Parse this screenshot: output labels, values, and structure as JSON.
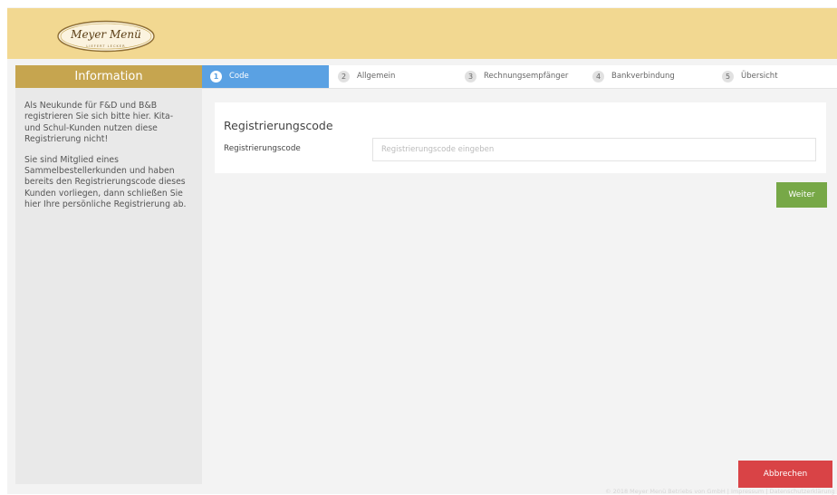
{
  "brand": {
    "name": "Meyer Menü",
    "tagline": "LIEFERT LECKER"
  },
  "sidebar": {
    "title": "Information",
    "paragraph_1": "Als Neukunde für F&D und B&B registrieren Sie sich bitte hier. Kita- und Schul-Kunden nutzen diese Registrierung nicht!",
    "paragraph_2": "Sie sind Mitglied eines Sammelbestellerkunden und haben bereits den Registrierungscode dieses Kunden vorliegen, dann schließen Sie hier Ihre persönliche Registrierung ab."
  },
  "steps": [
    {
      "number": "1",
      "label": "Code",
      "active": true
    },
    {
      "number": "2",
      "label": "Allgemein",
      "active": false
    },
    {
      "number": "3",
      "label": "Rechnungsempfänger",
      "active": false
    },
    {
      "number": "4",
      "label": "Bankverbindung",
      "active": false
    },
    {
      "number": "5",
      "label": "Übersicht",
      "active": false
    }
  ],
  "form": {
    "title": "Registrierungscode",
    "field_label": "Registrierungscode",
    "value": "",
    "placeholder": "Registrierungscode eingeben"
  },
  "buttons": {
    "next": "Weiter",
    "cancel": "Abbrechen"
  },
  "footer": {
    "text": "© 2018 Meyer Menü Betriebs von GmbH | Impressum | Datenschutzerklärung"
  },
  "colors": {
    "header": "#f2d891",
    "sidebar_head": "#c6a54f",
    "active_step": "#5aa1e3",
    "next_button": "#77a847",
    "cancel_button": "#d94346"
  }
}
